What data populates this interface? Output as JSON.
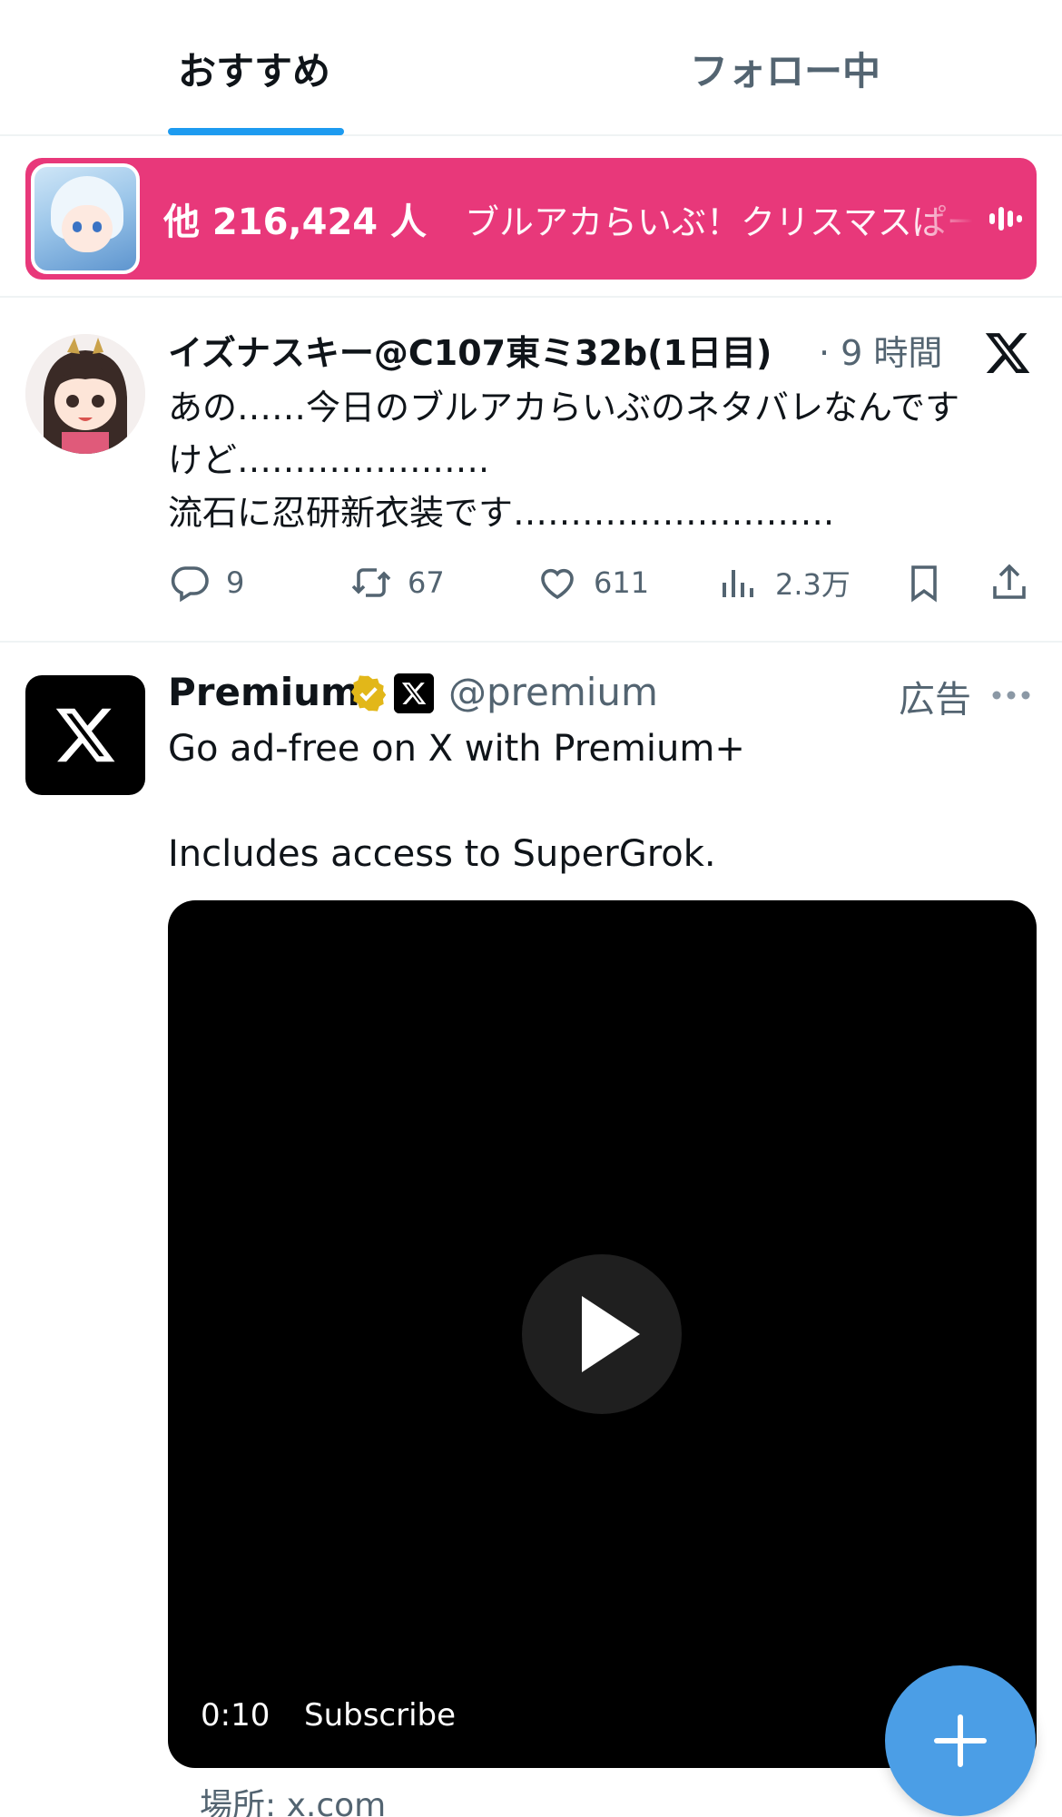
{
  "tabs": [
    {
      "label": "おすすめ",
      "active": true
    },
    {
      "label": "フォロー中",
      "active": false
    }
  ],
  "space": {
    "listeners": "他 216,424 人",
    "title": "ブルアカらいぶ！クリスマスぱーてぃー",
    "background": "#e8387a"
  },
  "tweet": {
    "author": "イズナスキー@C107東ミ32b(1日目)",
    "time": "· 9 時間",
    "text_lines": [
      "あの……今日のブルアカらいぶのネタバレなんです",
      "けど………………….",
      "流石に忍研新衣装です………………………."
    ],
    "replies": "9",
    "retweets": "67",
    "likes": "611",
    "views": "2.3万"
  },
  "ad": {
    "name": "Premium",
    "handle": "@premium",
    "label": "広告",
    "text_lines": [
      "Go ad-free on X with Premium+",
      "",
      "Includes access to SuperGrok."
    ],
    "video_time": "0:10",
    "video_cta": "Subscribe",
    "location": "場所: x.com"
  },
  "colors": {
    "accent": "#1d9bf0",
    "secondary_text": "#536471",
    "fab": "#4b9ee6",
    "verified_gold": "#e2b719"
  },
  "icons": {
    "reply": "reply-icon",
    "retweet": "retweet-icon",
    "like": "heart-icon",
    "views": "analytics-icon",
    "bookmark": "bookmark-icon",
    "share": "share-icon",
    "compose": "plus-icon"
  }
}
